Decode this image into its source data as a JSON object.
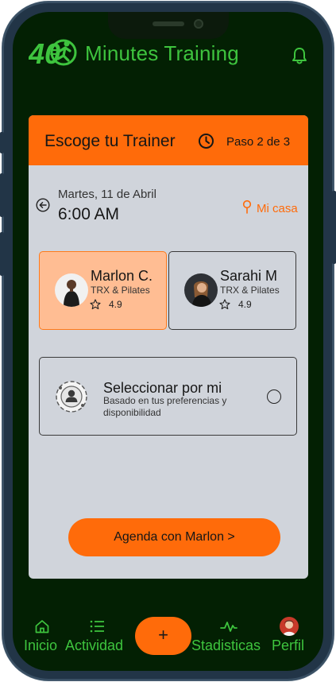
{
  "app": {
    "title": "Minutes Training",
    "logo_text": "40"
  },
  "colors": {
    "accent": "#ff6b0a",
    "brand_green": "#3ec43e",
    "background": "#032003",
    "card": "#d0d4db",
    "selected": "#ffbd93"
  },
  "card": {
    "title": "Escoge tu Trainer",
    "step": "Paso 2 de 3",
    "date": "Martes, 11 de Abril",
    "time": "6:00 AM",
    "location": "Mi casa"
  },
  "trainers": [
    {
      "name": "Marlon C.",
      "specialty": "TRX & Pilates",
      "rating": "4.9",
      "selected": true
    },
    {
      "name": "Sarahi M",
      "specialty": "TRX & Pilates",
      "rating": "4.9",
      "selected": false
    }
  ],
  "auto_select": {
    "title": "Seleccionar por mi",
    "subtitle": "Basado en tus preferencias y disponibilidad"
  },
  "cta": {
    "label": "Agenda con Marlon >"
  },
  "nav": {
    "items": [
      {
        "label": "Inicio",
        "icon": "home-icon"
      },
      {
        "label": "Actividad",
        "icon": "list-icon"
      },
      {
        "label": "Stadisticas",
        "icon": "pulse-icon"
      },
      {
        "label": "Perfil",
        "icon": "avatar"
      }
    ],
    "fab_label": "+"
  }
}
